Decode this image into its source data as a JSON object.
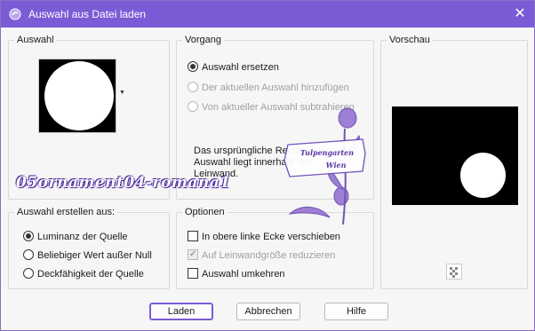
{
  "window": {
    "title": "Auswahl aus Datei laden",
    "accent": "#7b5bd6"
  },
  "auswahl": {
    "label": "Auswahl"
  },
  "vorgang": {
    "label": "Vorgang",
    "options": [
      {
        "label": "Auswahl ersetzen",
        "selected": true,
        "enabled": true
      },
      {
        "label": "Der aktuellen Auswahl hinzufügen",
        "selected": false,
        "enabled": false
      },
      {
        "label": "Von aktueller Auswahl subtrahieren",
        "selected": false,
        "enabled": false
      }
    ],
    "info_line1": "Das ursprüngliche Rechteck dieser",
    "info_line2": "Auswahl liegt innerhalb der",
    "info_line3": "Leinwand."
  },
  "vorschau": {
    "label": "Vorschau"
  },
  "erstellen": {
    "label": "Auswahl erstellen aus:",
    "options": [
      {
        "label": "Luminanz der Quelle",
        "selected": true
      },
      {
        "label": "Beliebiger Wert außer Null",
        "selected": false
      },
      {
        "label": "Deckfähigkeit der Quelle",
        "selected": false
      }
    ]
  },
  "optionen": {
    "label": "Optionen",
    "items": [
      {
        "label": "In obere linke Ecke verschieben",
        "checked": false,
        "enabled": true
      },
      {
        "label": "Auf Leinwandgröße reduzieren",
        "checked": true,
        "enabled": false
      },
      {
        "label": "Auswahl umkehren",
        "checked": false,
        "enabled": true
      }
    ]
  },
  "buttons": {
    "load": "Laden",
    "cancel": "Abbrechen",
    "help": "Hilfe"
  },
  "overlay": {
    "watermark": "05ornament04-romana1",
    "stamp_line1": "Tulpengarten",
    "stamp_line2": "Wien"
  }
}
